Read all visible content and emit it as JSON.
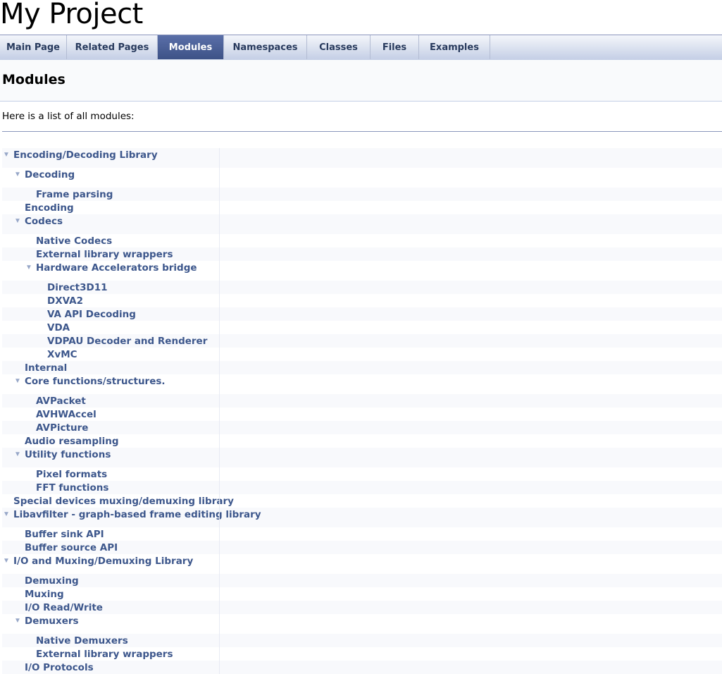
{
  "project": {
    "name": "My Project"
  },
  "nav": {
    "tabs": [
      {
        "label": "Main Page",
        "active": false
      },
      {
        "label": "Related Pages",
        "active": false
      },
      {
        "label": "Modules",
        "active": true
      },
      {
        "label": "Namespaces",
        "active": false
      },
      {
        "label": "Classes",
        "active": false
      },
      {
        "label": "Files",
        "active": false
      },
      {
        "label": "Examples",
        "active": false
      }
    ]
  },
  "header": {
    "title": "Modules"
  },
  "intro": {
    "text": "Here is a list of all modules:"
  },
  "tree": {
    "arrow_glyph": "▼",
    "items": [
      {
        "label": "Encoding/Decoding Library",
        "level": 0,
        "expanded": true
      },
      {
        "label": "Decoding",
        "level": 1,
        "expanded": true
      },
      {
        "label": "Frame parsing",
        "level": 2,
        "expanded": false
      },
      {
        "label": "Encoding",
        "level": 1,
        "expanded": false
      },
      {
        "label": "Codecs",
        "level": 1,
        "expanded": true
      },
      {
        "label": "Native Codecs",
        "level": 2,
        "expanded": false
      },
      {
        "label": "External library wrappers",
        "level": 2,
        "expanded": false
      },
      {
        "label": "Hardware Accelerators bridge",
        "level": 2,
        "expanded": true
      },
      {
        "label": "Direct3D11",
        "level": 3,
        "expanded": false
      },
      {
        "label": "DXVA2",
        "level": 3,
        "expanded": false
      },
      {
        "label": "VA API Decoding",
        "level": 3,
        "expanded": false
      },
      {
        "label": "VDA",
        "level": 3,
        "expanded": false
      },
      {
        "label": "VDPAU Decoder and Renderer",
        "level": 3,
        "expanded": false
      },
      {
        "label": "XvMC",
        "level": 3,
        "expanded": false
      },
      {
        "label": "Internal",
        "level": 1,
        "expanded": false
      },
      {
        "label": "Core functions/structures.",
        "level": 1,
        "expanded": true
      },
      {
        "label": "AVPacket",
        "level": 2,
        "expanded": false
      },
      {
        "label": "AVHWAccel",
        "level": 2,
        "expanded": false
      },
      {
        "label": "AVPicture",
        "level": 2,
        "expanded": false
      },
      {
        "label": "Audio resampling",
        "level": 1,
        "expanded": false
      },
      {
        "label": "Utility functions",
        "level": 1,
        "expanded": true
      },
      {
        "label": "Pixel formats",
        "level": 2,
        "expanded": false
      },
      {
        "label": "FFT functions",
        "level": 2,
        "expanded": false
      },
      {
        "label": "Special devices muxing/demuxing library",
        "level": 0,
        "expanded": false
      },
      {
        "label": "Libavfilter - graph-based frame editing library",
        "level": 0,
        "expanded": true
      },
      {
        "label": "Buffer sink API",
        "level": 1,
        "expanded": false
      },
      {
        "label": "Buffer source API",
        "level": 1,
        "expanded": false
      },
      {
        "label": "I/O and Muxing/Demuxing Library",
        "level": 0,
        "expanded": true
      },
      {
        "label": "Demuxing",
        "level": 1,
        "expanded": false
      },
      {
        "label": "Muxing",
        "level": 1,
        "expanded": false
      },
      {
        "label": "I/O Read/Write",
        "level": 1,
        "expanded": false
      },
      {
        "label": "Demuxers",
        "level": 1,
        "expanded": true
      },
      {
        "label": "Native Demuxers",
        "level": 2,
        "expanded": false
      },
      {
        "label": "External library wrappers",
        "level": 2,
        "expanded": false
      },
      {
        "label": "I/O Protocols",
        "level": 1,
        "expanded": false
      }
    ]
  }
}
